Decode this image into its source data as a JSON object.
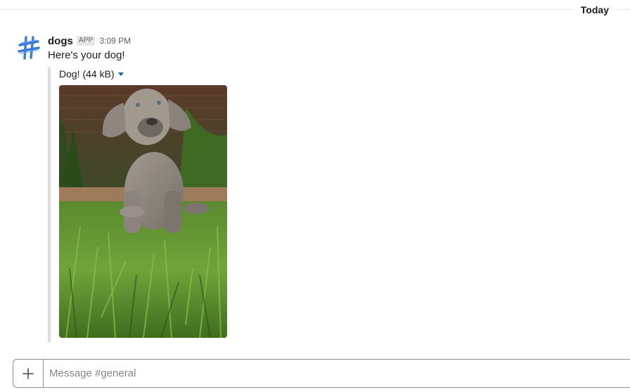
{
  "divider": {
    "label": "Today"
  },
  "message": {
    "sender": "dogs",
    "badge": "APP",
    "time": "3:09 PM",
    "text": "Here's your dog!",
    "attachment": {
      "title": "Dog! (44 kB)",
      "image": "photo of a grey weimaraner puppy lying on grass"
    }
  },
  "composer": {
    "placeholder": "Message #general",
    "value": ""
  },
  "colors": {
    "link_blue": "#1264a3",
    "avatar_blue": "#3b7dd8",
    "divider": "#e4e4e4",
    "attachment_bar": "#dddddd"
  }
}
